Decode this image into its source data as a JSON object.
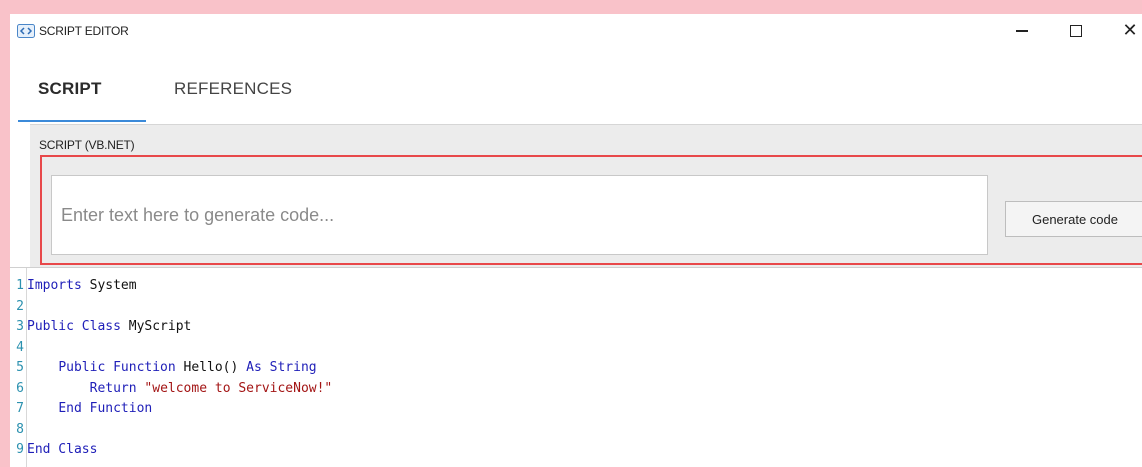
{
  "window": {
    "title": "SCRIPT EDITOR",
    "controls": {
      "minimize": "—",
      "maximize": "☐",
      "close": "✕"
    }
  },
  "tabs": [
    {
      "label": "SCRIPT",
      "active": true
    },
    {
      "label": "REFERENCES",
      "active": false
    }
  ],
  "script_panel": {
    "label": "SCRIPT (VB.NET)",
    "input_placeholder": "Enter text here to generate code...",
    "input_value": "",
    "generate_button": "Generate code"
  },
  "editor": {
    "lines": [
      {
        "num": "1",
        "parts": [
          {
            "t": "kw",
            "v": "Imports"
          },
          {
            "t": "txt",
            "v": " System"
          }
        ]
      },
      {
        "num": "2",
        "parts": []
      },
      {
        "num": "3",
        "parts": [
          {
            "t": "kw",
            "v": "Public Class"
          },
          {
            "t": "txt",
            "v": " MyScript"
          }
        ]
      },
      {
        "num": "4",
        "parts": []
      },
      {
        "num": "5",
        "parts": [
          {
            "t": "txt",
            "v": "    "
          },
          {
            "t": "kw",
            "v": "Public Function"
          },
          {
            "t": "txt",
            "v": " Hello() "
          },
          {
            "t": "kw",
            "v": "As String"
          }
        ]
      },
      {
        "num": "6",
        "parts": [
          {
            "t": "txt",
            "v": "        "
          },
          {
            "t": "kw",
            "v": "Return"
          },
          {
            "t": "txt",
            "v": " "
          },
          {
            "t": "str",
            "v": "\"welcome to ServiceNow!\""
          }
        ]
      },
      {
        "num": "7",
        "parts": [
          {
            "t": "txt",
            "v": "    "
          },
          {
            "t": "kw",
            "v": "End Function"
          }
        ]
      },
      {
        "num": "8",
        "parts": []
      },
      {
        "num": "9",
        "parts": [
          {
            "t": "kw",
            "v": "End Class"
          }
        ]
      }
    ]
  },
  "colors": {
    "accent": "#3b8ad9",
    "highlight_border": "#e8484a",
    "keyword": "#1f1fb8",
    "string": "#a31515",
    "line_number": "#2b91af",
    "background_margin": "#f9c2c9"
  },
  "icons": {
    "app": "code-brackets-icon"
  }
}
